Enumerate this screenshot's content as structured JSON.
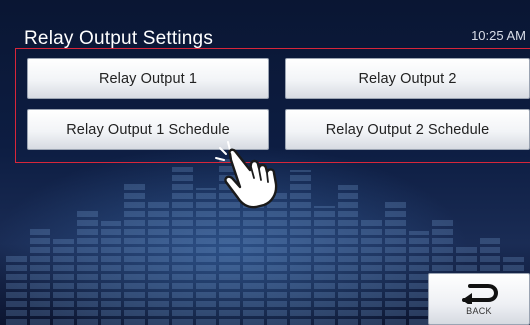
{
  "header": {
    "title": "Relay Output Settings",
    "time": "10:25 AM"
  },
  "buttons": [
    {
      "label": "Relay Output 1"
    },
    {
      "label": "Relay Output 2"
    },
    {
      "label": "Relay Output 1 Schedule"
    },
    {
      "label": "Relay Output 2 Schedule"
    }
  ],
  "footer": {
    "back_label": "BACK",
    "back_icon": "return-arrow-icon"
  },
  "overlay": {
    "pointer_icon": "pointing-hand-icon",
    "highlight_color": "#d8263a"
  }
}
